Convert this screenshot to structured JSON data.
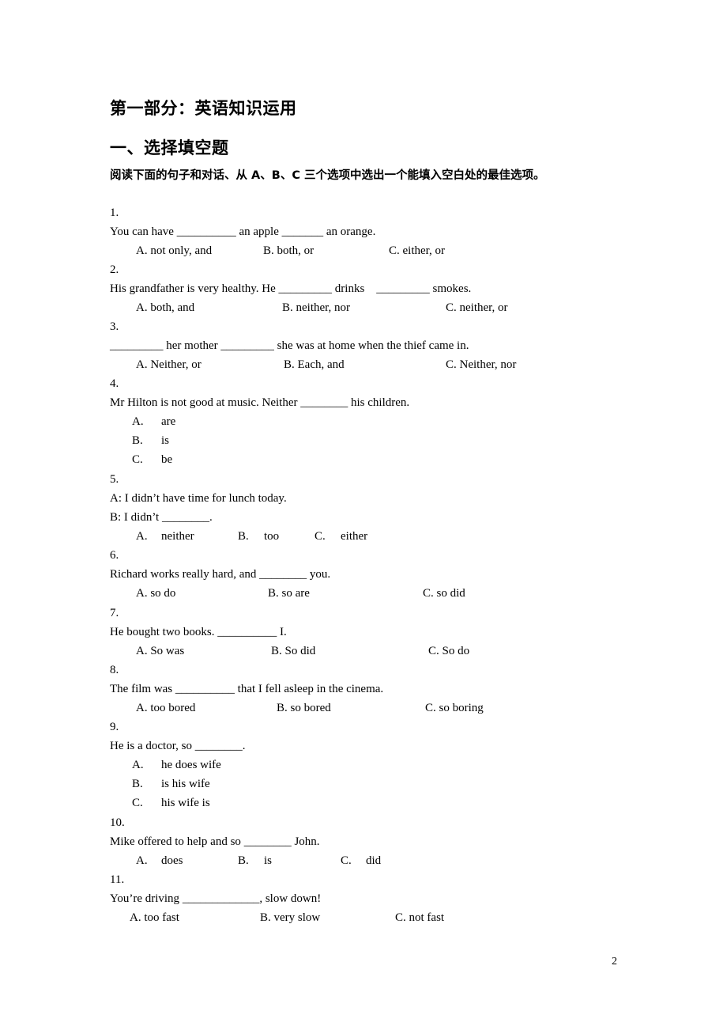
{
  "page": {
    "part_title": "第一部分：英语知识运用",
    "section_title": "一、选择填空题",
    "instructions": "阅读下面的句子和对话、从 A、B、C 三个选项中选出一个能填入空白处的最佳选项。",
    "page_number": "2"
  },
  "questions": [
    {
      "number": "1.",
      "stem": [
        "You can have ",
        "__________",
        " an apple ",
        "_______",
        " an orange."
      ],
      "options": [
        "A. not only, and",
        "B. both, or",
        "C. either, or"
      ]
    },
    {
      "number": "2.",
      "stem": [
        "His grandfather is very healthy. He ",
        "_________",
        " drinks    ",
        "_________",
        " smokes."
      ],
      "options": [
        "A. both, and",
        "B. neither, nor",
        "C. neither, or"
      ]
    },
    {
      "number": "3.",
      "stem": [
        "_________",
        " her mother ",
        "_________",
        " she was at home when the thief came in."
      ],
      "options": [
        "A. Neither, or",
        "B. Each, and",
        "C. Neither, nor"
      ]
    },
    {
      "number": "4.",
      "stem": [
        "Mr Hilton is not good at music. Neither ",
        "________",
        " his children."
      ],
      "options_vertical": [
        {
          "letter": "A.",
          "text": "are"
        },
        {
          "letter": "B.",
          "text": "is"
        },
        {
          "letter": "C.",
          "text": "be"
        }
      ]
    },
    {
      "number": "5.",
      "lines": [
        "A: I didn’t have time for lunch today.",
        "B: I didn’t ________."
      ],
      "options_spaced": [
        {
          "letter": "A.",
          "text": "neither"
        },
        {
          "letter": "B.",
          "text": "too"
        },
        {
          "letter": "C.",
          "text": "either"
        }
      ]
    },
    {
      "number": "6.",
      "stem": [
        "Richard works really hard, and ",
        "________",
        " you."
      ],
      "options": [
        "A. so do",
        "B. so are",
        "C. so did"
      ]
    },
    {
      "number": "7.",
      "stem": [
        "He bought two books. ",
        "__________",
        " I."
      ],
      "options": [
        "A. So was",
        "B. So did",
        "C. So do"
      ]
    },
    {
      "number": "8.",
      "stem": [
        "The film was ",
        "__________",
        " that I fell asleep in the cinema."
      ],
      "options": [
        "A. too bored",
        "B. so bored",
        "C. so boring"
      ]
    },
    {
      "number": "9.",
      "stem": [
        "He is a doctor, so ",
        "________",
        "."
      ],
      "options_vertical": [
        {
          "letter": "A.",
          "text": "he does wife"
        },
        {
          "letter": "B.",
          "text": "is his wife"
        },
        {
          "letter": "C.",
          "text": "his wife is"
        }
      ]
    },
    {
      "number": "10.",
      "stem": [
        "Mike offered to help and so ",
        "________",
        " John."
      ],
      "options_spaced": [
        {
          "letter": "A.",
          "text": "does"
        },
        {
          "letter": "B.",
          "text": "is"
        },
        {
          "letter": "C.",
          "text": "did"
        }
      ]
    },
    {
      "number": "11.",
      "stem": [
        "You’re driving ",
        "_____________",
        ", slow down!"
      ],
      "options": [
        "A. too fast",
        "B. very slow",
        "C. not fast"
      ]
    }
  ]
}
